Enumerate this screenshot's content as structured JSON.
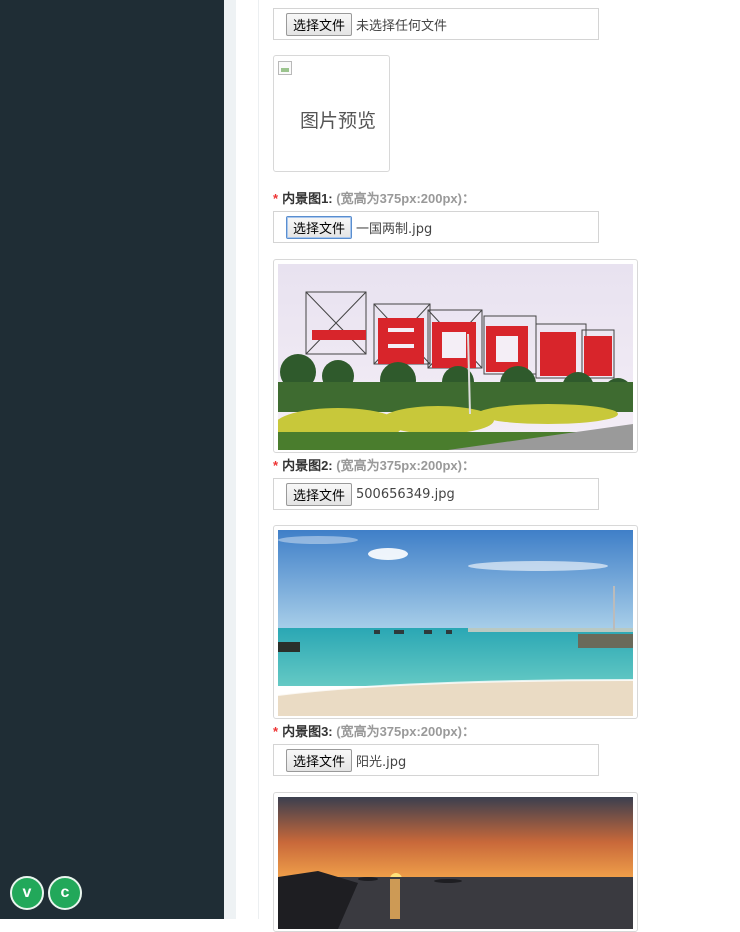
{
  "avatars": [
    "v",
    "c"
  ],
  "file_button_label": "选择文件",
  "cover_field": {
    "file_name": "未选择任何文件",
    "preview_alt": "图片预览"
  },
  "inner_images": [
    {
      "label": "内景图1:",
      "hint": "(宽高为375px:200px)：",
      "file_name": "一国两制.jpg",
      "scene": "slogan sign with red characters on a hillside with hedges",
      "slogan": "一国两制统一中国"
    },
    {
      "label": "内景图2:",
      "hint": "(宽高为375px:200px)：",
      "file_name": "500656349.jpg",
      "scene": "beach with turquoise sea, boats and pier"
    },
    {
      "label": "内景图3:",
      "hint": "(宽高为375px:200px)：",
      "file_name": "阳光.jpg",
      "scene": "sunset over the sea"
    }
  ],
  "required_mark": "*",
  "colors": {
    "sidebar": "#1f2d35",
    "avatar": "#22a85a",
    "required": "#e33333"
  }
}
